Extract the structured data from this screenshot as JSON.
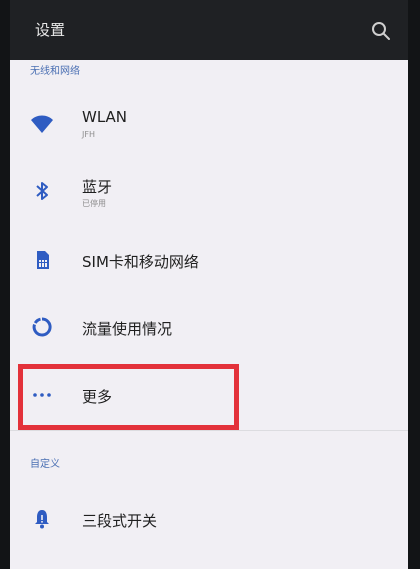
{
  "appbar": {
    "title": "设置",
    "search_icon": "search-icon"
  },
  "sections": [
    {
      "header": "无线和网络",
      "items": [
        {
          "title": "WLAN",
          "subtitle": "JFH",
          "icon": "wifi-icon"
        },
        {
          "title": "蓝牙",
          "subtitle": "已停用",
          "icon": "bluetooth-icon"
        },
        {
          "title": "SIM卡和移动网络",
          "icon": "sim-card-icon"
        },
        {
          "title": "流量使用情况",
          "icon": "data-usage-icon"
        },
        {
          "title": "更多",
          "icon": "more-icon"
        }
      ]
    },
    {
      "header": "自定义",
      "items": [
        {
          "title": "三段式开关",
          "icon": "bell-icon"
        }
      ]
    }
  ],
  "colors": {
    "appbar_bg": "#1f2124",
    "list_bg": "#f1eff4",
    "accent": "#2f5cc2",
    "highlight": "#e3313a"
  }
}
